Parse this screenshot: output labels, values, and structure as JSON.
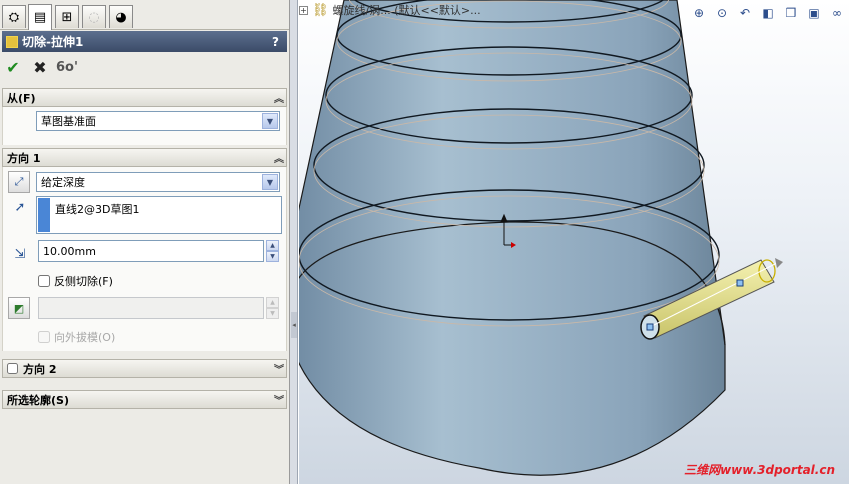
{
  "panel": {
    "tabs": [
      {
        "name": "feature-manager"
      },
      {
        "name": "property-manager"
      },
      {
        "name": "configuration-manager"
      },
      {
        "name": "dim-xpert"
      },
      {
        "name": "display-manager"
      }
    ],
    "title": "切除-拉伸1",
    "help": "?",
    "actions": {
      "ok": "✔",
      "cancel": "✖",
      "preview": "6o'"
    }
  },
  "from_group": {
    "header": "从(F)",
    "start_condition": "草图基准面"
  },
  "direction1": {
    "header": "方向 1",
    "end_condition": "给定深度",
    "selection_item": "直线2@3D草图1",
    "depth": "10.00mm",
    "flip_side_label": "反侧切除(F)",
    "draft_outward_label": "向外拔模(O)"
  },
  "direction2": {
    "header": "方向 2"
  },
  "selected_contours": {
    "header": "所选轮廓(S)"
  },
  "viewport": {
    "tree_text": "螺旋线/涡... (默认<<默认>...",
    "toolbar_icons": [
      "zoom-to-fit-icon",
      "zoom-area-icon",
      "previous-view-icon",
      "section-view-icon",
      "view-orientation-icon",
      "display-style-icon",
      "hide-show-icon"
    ],
    "watermark": "三维网www.3dportal.cn"
  },
  "colors": {
    "title_bar": "#4a5b7a",
    "model_body": "#9fb7c8",
    "extrude_preview": "#e8e48a",
    "watermark": "#e4202a"
  }
}
